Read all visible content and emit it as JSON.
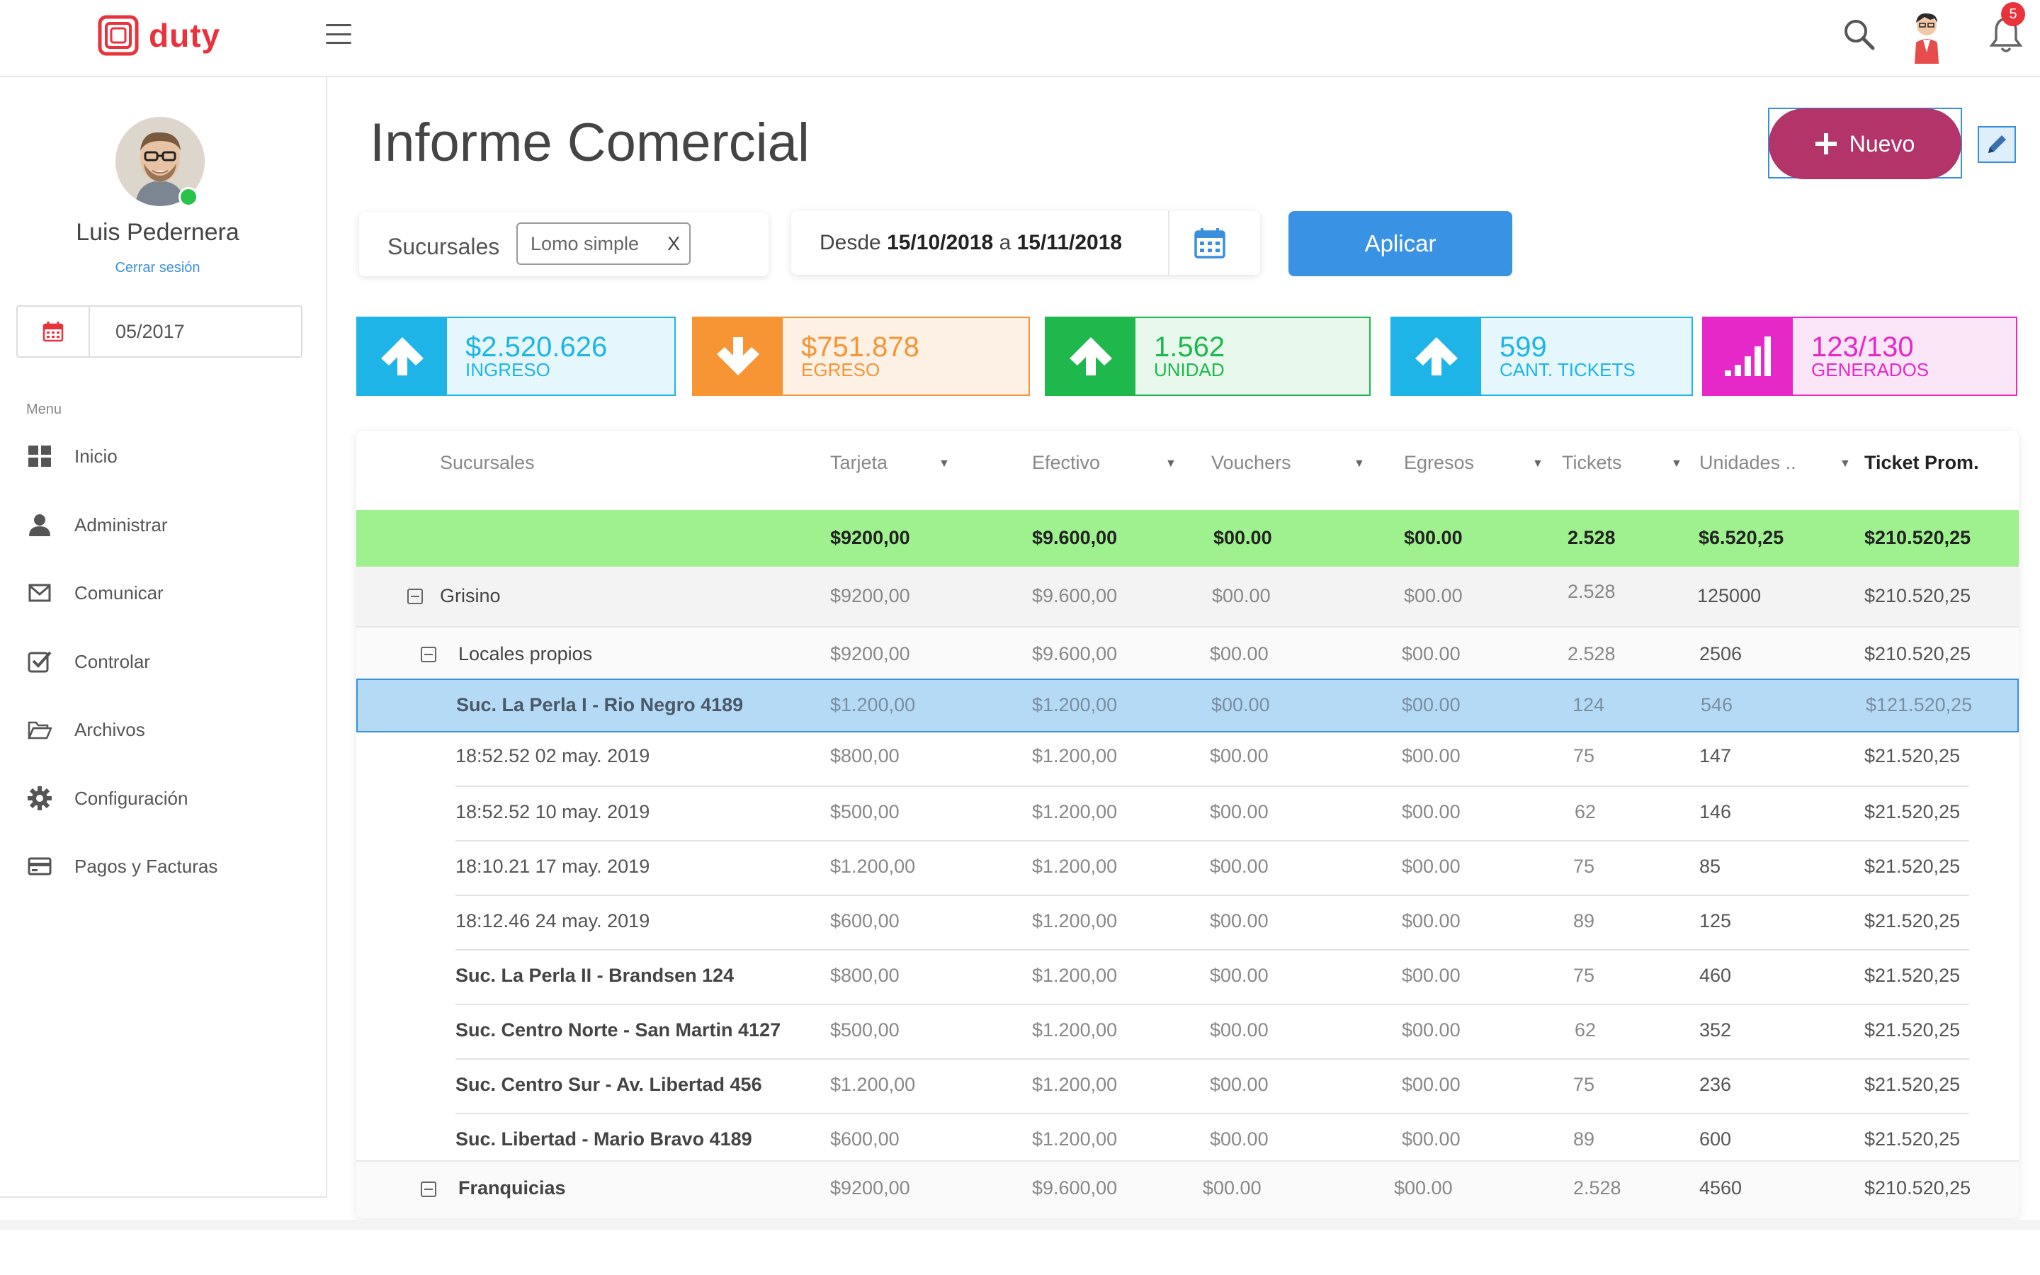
{
  "app": {
    "brand": "duty",
    "notifications_count": "5"
  },
  "user": {
    "name": "Luis Pedernera",
    "logout_label": "Cerrar sesión",
    "period": "05/2017"
  },
  "menu": {
    "title": "Menu",
    "items": [
      {
        "label": "Inicio",
        "icon": "grid-icon"
      },
      {
        "label": "Administrar",
        "icon": "user-icon"
      },
      {
        "label": "Comunicar",
        "icon": "envelope-icon"
      },
      {
        "label": "Controlar",
        "icon": "checkbox-icon"
      },
      {
        "label": "Archivos",
        "icon": "folder-icon"
      },
      {
        "label": "Configuración",
        "icon": "gear-icon"
      },
      {
        "label": "Pagos y Facturas",
        "icon": "credit-card-icon"
      }
    ]
  },
  "page": {
    "title": "Informe Comercial",
    "new_label": "Nuevo"
  },
  "filters": {
    "sucursales_label": "Sucursales",
    "chip_label": "Lomo simple",
    "chip_remove": "X",
    "date_prefix": "Desde",
    "date_from": "15/10/2018",
    "date_sep": "a",
    "date_to": "15/11/2018",
    "apply_label": "Aplicar"
  },
  "kpis": [
    {
      "value": "$2.520.626",
      "label": "INGRESO",
      "color": "#1fb4e8",
      "bg": "#e5f7fd",
      "icon": "arrow-up-icon"
    },
    {
      "value": "$751.878",
      "label": "EGRESO",
      "color": "#f79433",
      "bg": "#fdf1e6",
      "icon": "arrow-down-icon"
    },
    {
      "value": "1.562",
      "label": "UNIDAD",
      "color": "#1eb84d",
      "bg": "#e8f8ec",
      "icon": "arrow-up-icon"
    },
    {
      "value": "599",
      "label": "CANT. TICKETS",
      "color": "#1fb4e8",
      "bg": "#e5f7fd",
      "icon": "arrow-up-icon"
    },
    {
      "value": "123/130",
      "label": "GENERADOS",
      "color": "#e628c9",
      "bg": "#fbe6f8",
      "icon": "signal-bars-icon"
    }
  ],
  "table": {
    "headers": [
      "Sucursales",
      "Tarjeta",
      "Efectivo",
      "Vouchers",
      "Egresos",
      "Tickets",
      "Unidades ..",
      "Ticket Prom."
    ],
    "totals": [
      "$9200,00",
      "$9.600,00",
      "$00.00",
      "$00.00",
      "2.528",
      "$6.520,25",
      "$210.520,25"
    ],
    "group": {
      "name": "Grisino",
      "values": [
        "$9200,00",
        "$9.600,00",
        "$00.00",
        "$00.00",
        "2.528",
        "125000",
        "$210.520,25"
      ]
    },
    "subgroup": {
      "name": "Locales propios",
      "values": [
        "$9200,00",
        "$9.600,00",
        "$00.00",
        "$00.00",
        "2.528",
        "2506",
        "$210.520,25"
      ]
    },
    "selected": {
      "name": "Suc. La Perla I - Rio Negro 4189",
      "values": [
        "$1.200,00",
        "$1.200,00",
        "$00.00",
        "$00.00",
        "124",
        "546",
        "$121.520,25"
      ]
    },
    "rows": [
      {
        "name": "18:52.52 02 may. 2019",
        "values": [
          "$800,00",
          "$1.200,00",
          "$00.00",
          "$00.00",
          "75",
          "147",
          "$21.520,25"
        ]
      },
      {
        "name": "18:52.52 10 may. 2019",
        "values": [
          "$500,00",
          "$1.200,00",
          "$00.00",
          "$00.00",
          "62",
          "146",
          "$21.520,25"
        ]
      },
      {
        "name": "18:10.21 17 may. 2019",
        "values": [
          "$1.200,00",
          "$1.200,00",
          "$00.00",
          "$00.00",
          "75",
          "85",
          "$21.520,25"
        ]
      },
      {
        "name": "18:12.46 24 may. 2019",
        "values": [
          "$600,00",
          "$1.200,00",
          "$00.00",
          "$00.00",
          "89",
          "125",
          "$21.520,25"
        ]
      },
      {
        "name": "Suc. La Perla II - Brandsen 124",
        "values": [
          "$800,00",
          "$1.200,00",
          "$00.00",
          "$00.00",
          "75",
          "460",
          "$21.520,25"
        ]
      },
      {
        "name": "Suc. Centro Norte - San Martin 4127",
        "values": [
          "$500,00",
          "$1.200,00",
          "$00.00",
          "$00.00",
          "62",
          "352",
          "$21.520,25"
        ]
      },
      {
        "name": "Suc. Centro Sur - Av. Libertad 456",
        "values": [
          "$1.200,00",
          "$1.200,00",
          "$00.00",
          "$00.00",
          "75",
          "236",
          "$21.520,25"
        ]
      },
      {
        "name": "Suc. Libertad - Mario Bravo 4189",
        "values": [
          "$600,00",
          "$1.200,00",
          "$00.00",
          "$00.00",
          "89",
          "600",
          "$21.520,25"
        ]
      }
    ],
    "franchise": {
      "name": "Franquicias",
      "values": [
        "$9200,00",
        "$9.600,00",
        "$00.00",
        "$00.00",
        "2.528",
        "4560",
        "$210.520,25"
      ]
    }
  }
}
